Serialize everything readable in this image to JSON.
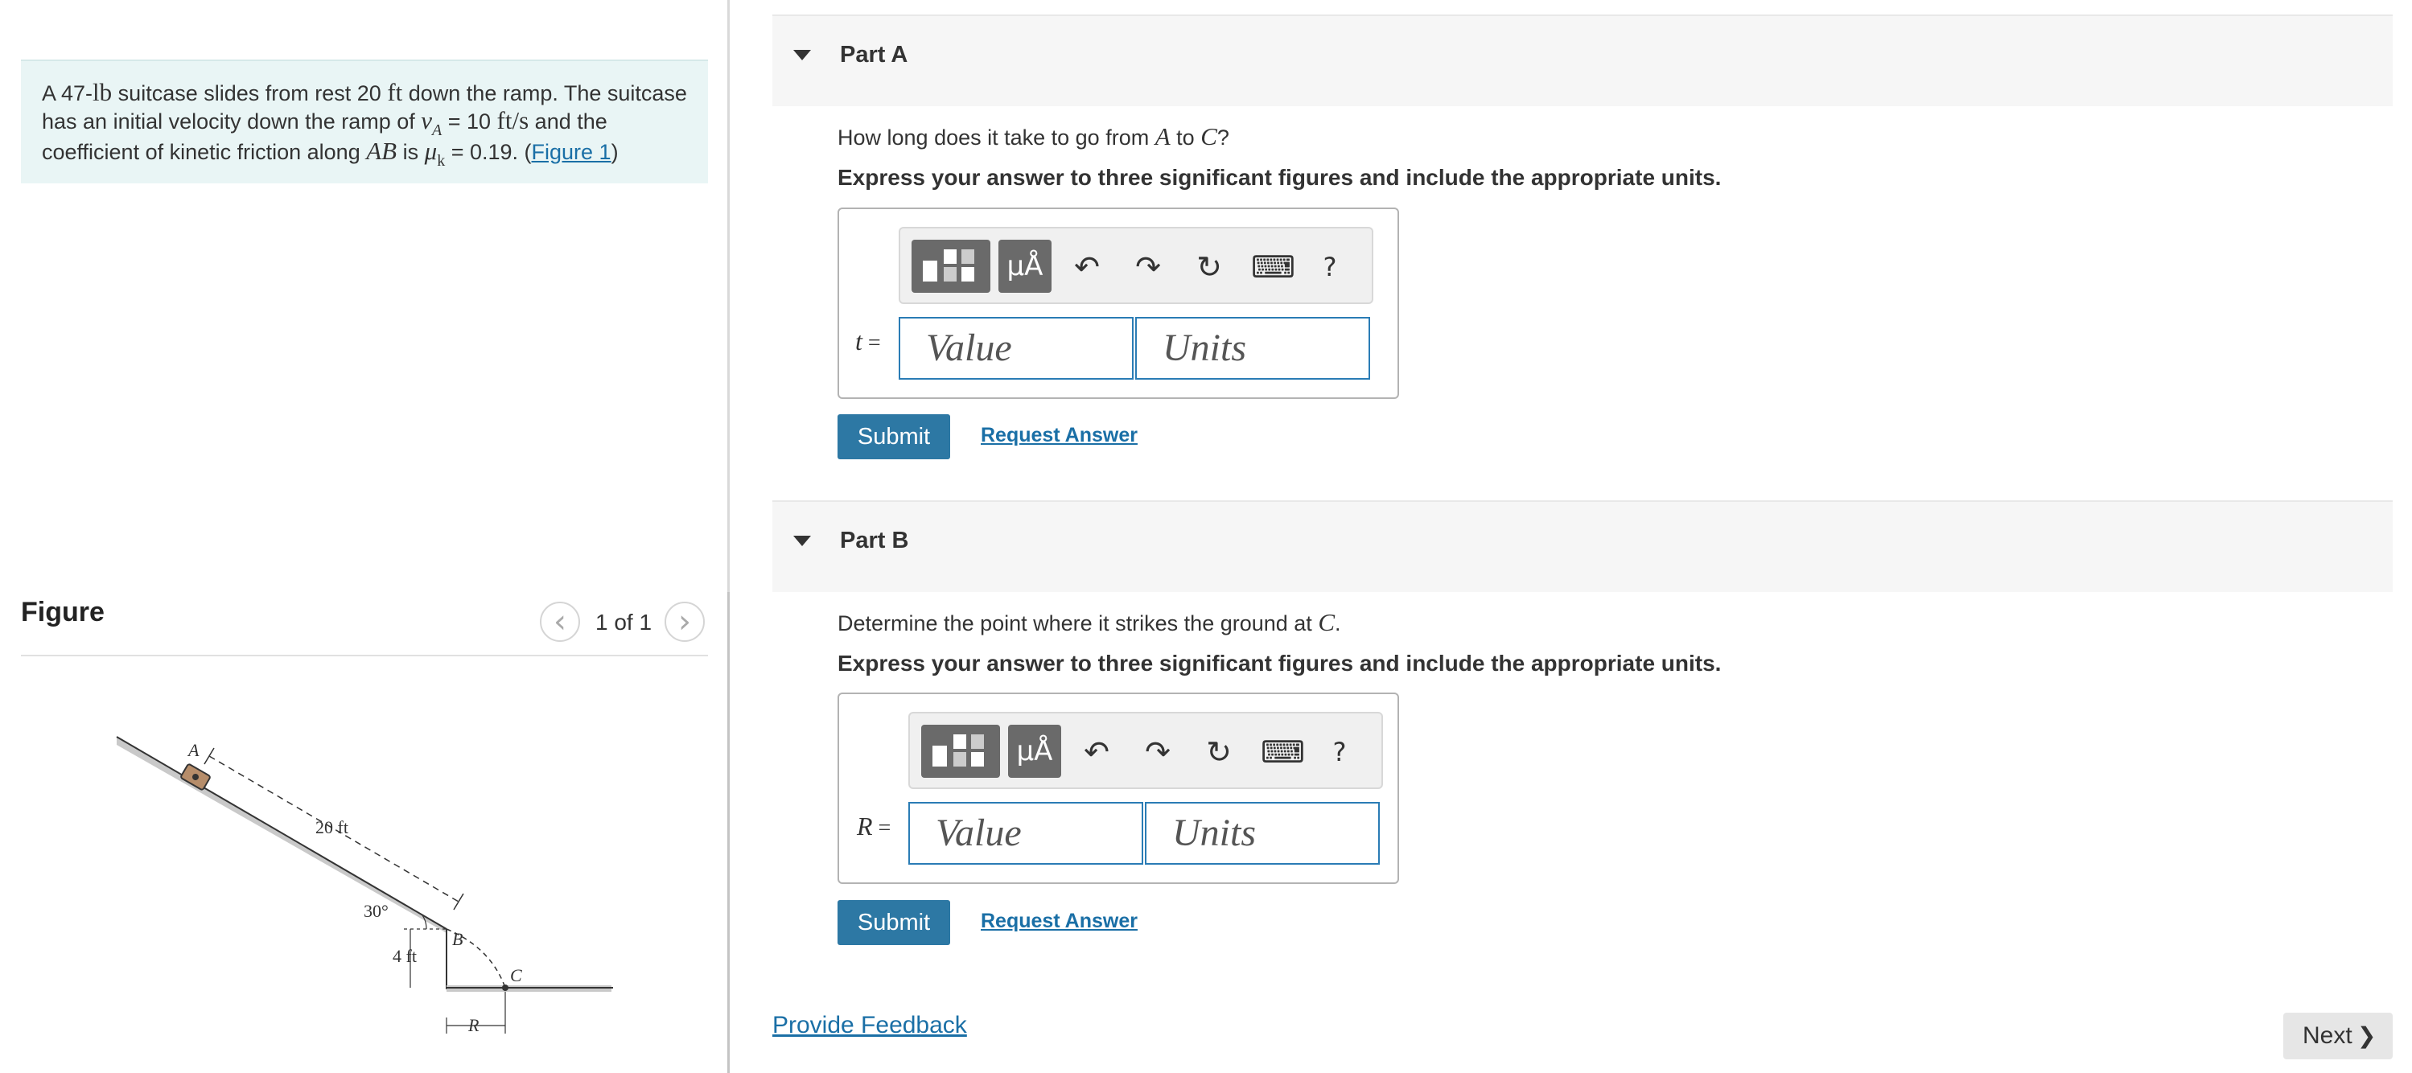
{
  "problem": {
    "pre_weight": "A 47-",
    "weight_unit": "lb",
    "mid1": " suitcase slides from rest 20 ",
    "dist_unit": "ft",
    "mid2": " down the ramp. The suitcase has an initial velocity down the ramp of ",
    "v_symbol": "v",
    "v_sub": "A",
    "v_eq": " = 10 ",
    "v_unit": "ft/s",
    "mid3": " and the coefficient of kinetic friction along ",
    "segment": "AB",
    "mid4": " is ",
    "mu_symbol": "μ",
    "mu_sub": "k",
    "mu_eq": " = 0.19. (",
    "figure_link": "Figure 1",
    "close": ")"
  },
  "figure": {
    "title": "Figure",
    "counter": "1 of 1",
    "labels": {
      "a": "A",
      "b": "B",
      "c": "C",
      "dist": "20 ft",
      "angle": "30°",
      "height": "4 ft",
      "r": "R"
    }
  },
  "parts": [
    {
      "title": "Part A",
      "question_pre": "How long does it take to go from ",
      "q_a": "A",
      "q_mid": " to ",
      "q_c": "C",
      "question_post": "?",
      "instruction": "Express your answer to three significant figures and include the appropriate units.",
      "var": "t",
      "eq": " =",
      "value_placeholder": "Value",
      "units_placeholder": "Units",
      "submit": "Submit",
      "request": "Request Answer"
    },
    {
      "title": "Part B",
      "question_pre": "Determine the point where it strikes the ground at ",
      "q_c": "C",
      "question_post": ".",
      "instruction": "Express your answer to three significant figures and include the appropriate units.",
      "var": "R",
      "eq": " =",
      "value_placeholder": "Value",
      "units_placeholder": "Units",
      "submit": "Submit",
      "request": "Request Answer"
    }
  ],
  "toolbar": {
    "units_glyph": "μÅ",
    "undo_glyph": "↶",
    "redo_glyph": "↷",
    "reset_glyph": "↻",
    "keyboard_glyph": "⌨",
    "help_glyph": "?"
  },
  "footer": {
    "feedback": "Provide Feedback",
    "next": "Next",
    "next_chevron": "❯"
  },
  "nav": {
    "prev_glyph": "‹",
    "next_glyph": "›"
  },
  "colors": {
    "accent": "#2d78a4",
    "link": "#1a6fa6",
    "problem_bg": "#e9f5f5",
    "field_border": "#2a7cb5"
  }
}
